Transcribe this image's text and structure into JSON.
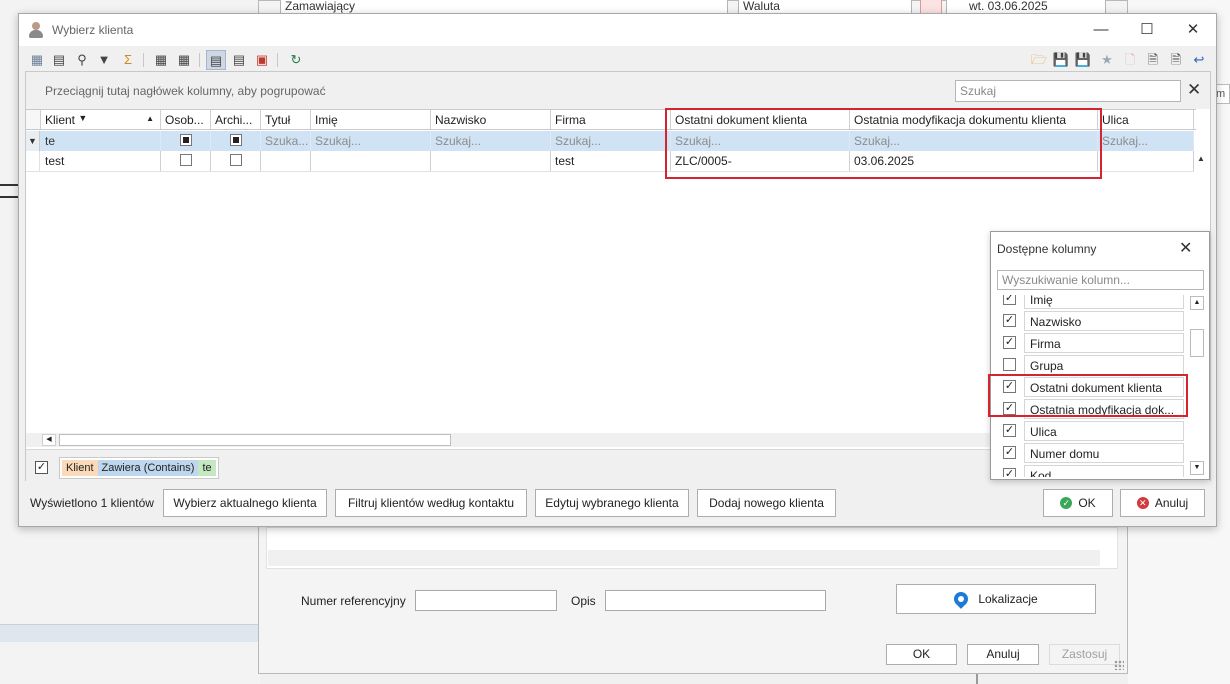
{
  "background_window": {
    "field_zamawiajacy": "Zamawiający",
    "field_waluta": "Waluta",
    "field_date": "wt. 03.06.2025",
    "label_numer_ref": "Numer referencyjny",
    "label_opis": "Opis",
    "btn_lokalizacje": "Lokalizacje",
    "btn_ok": "OK",
    "btn_anuluj": "Anuluj",
    "btn_zastosuj": "Zastosuj",
    "right_box_text": "m"
  },
  "dialog": {
    "title": "Wybierz klienta",
    "group_hint": "Przeciągnij tutaj nagłówek kolumny, aby pogrupować",
    "search_placeholder": "Szukaj",
    "columns": [
      "Klient",
      "Osob...",
      "Archi...",
      "Tytuł",
      "Imię",
      "Nazwisko",
      "Firma",
      "Ostatni dokument klienta",
      "Ostatnia modyfikacja dokumentu klienta",
      "Ulica"
    ],
    "filter_row": {
      "klient": "te",
      "tytul": "Szuka...",
      "imie": "Szukaj...",
      "nazwisko": "Szukaj...",
      "firma": "Szukaj...",
      "ostatni_dok": "Szukaj...",
      "ostatnia_mod": "Szukaj...",
      "ulica": "Szukaj..."
    },
    "rows": [
      {
        "klient": "test",
        "osob": false,
        "archi": false,
        "tytul": "",
        "imie": "",
        "nazwisko": "",
        "firma": "test",
        "ostatni_dok": "ZLC/0005-",
        "ostatnia_mod": "03.06.2025",
        "ulica": ""
      }
    ],
    "filter_tokens": [
      "Klient",
      "Zawiera (Contains)",
      "te"
    ],
    "count_label": "Wyświetlono 1 klientów",
    "buttons": {
      "select_current": "Wybierz aktualnego klienta",
      "filter_by_contact": "Filtruj klientów według kontaktu",
      "edit_selected": "Edytuj wybranego klienta",
      "add_new": "Dodaj nowego klienta",
      "ok": "OK",
      "cancel": "Anuluj"
    }
  },
  "column_chooser": {
    "title": "Dostępne kolumny",
    "search_placeholder": "Wyszukiwanie kolumn...",
    "items": [
      {
        "label": "Imię",
        "checked": true
      },
      {
        "label": "Nazwisko",
        "checked": true
      },
      {
        "label": "Firma",
        "checked": true
      },
      {
        "label": "Grupa",
        "checked": false
      },
      {
        "label": "Ostatni dokument klienta",
        "checked": true
      },
      {
        "label": "Ostatnia modyfikacja dok...",
        "checked": true
      },
      {
        "label": "Ulica",
        "checked": true
      },
      {
        "label": "Numer domu",
        "checked": true
      },
      {
        "label": "Kod",
        "checked": true
      }
    ]
  },
  "colors": {
    "highlight": "#d3242f",
    "filter_row_bg": "#cfe3f4",
    "token_field": "#fcd9b8",
    "token_operator": "#bed7ee",
    "token_value": "#c5e8c2"
  }
}
